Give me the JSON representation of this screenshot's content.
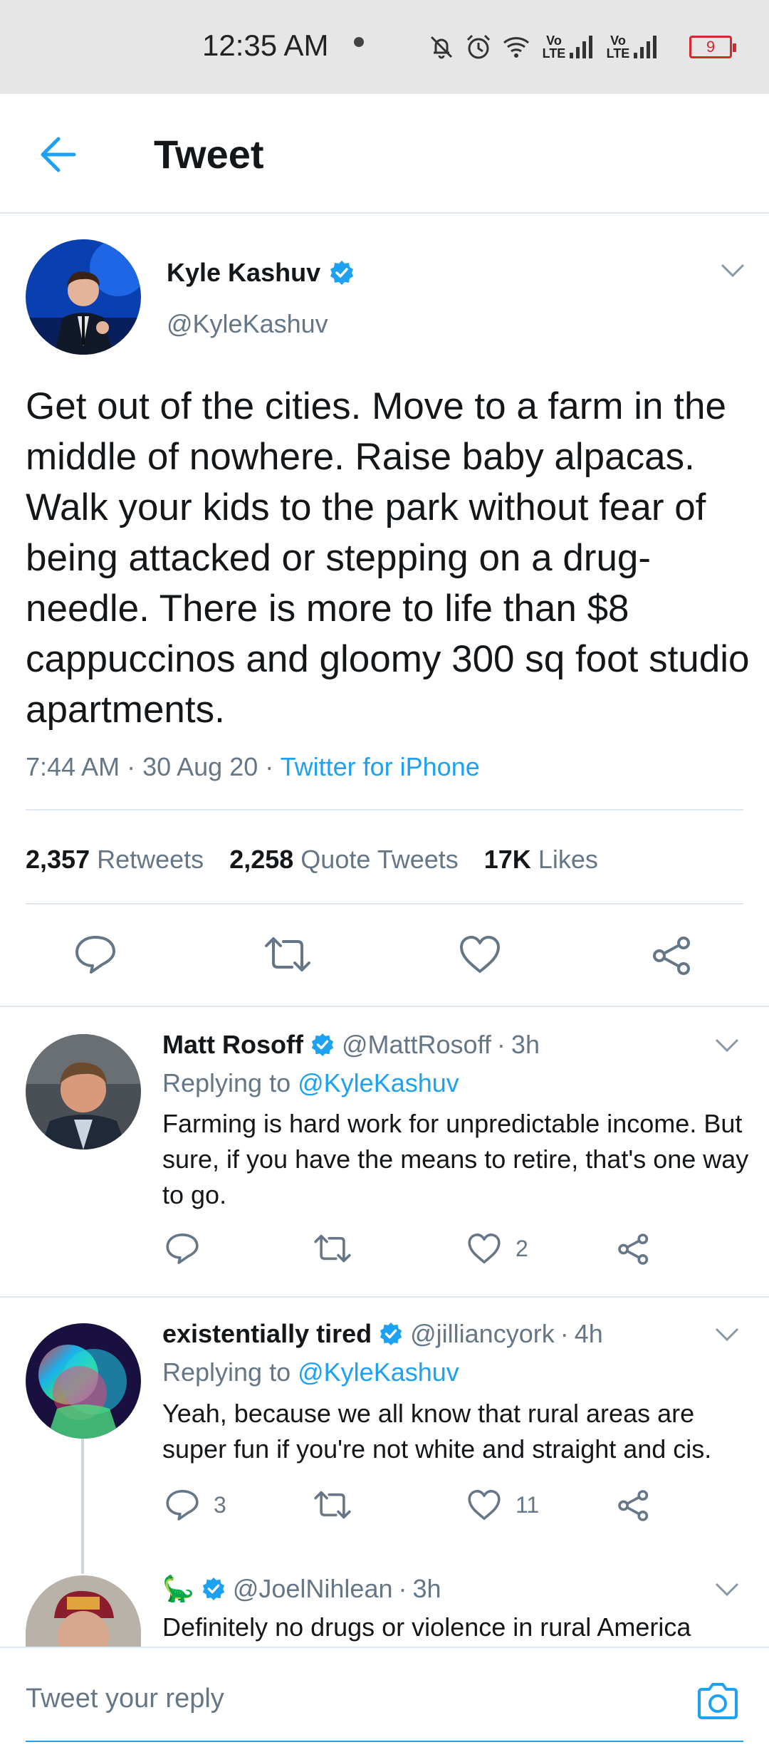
{
  "status_bar": {
    "time": "12:35 AM",
    "network_1": "Vo LTE",
    "network_2": "Vo LTE",
    "battery": "9",
    "icons": [
      "mute-icon",
      "alarm-icon",
      "wifi-icon",
      "signal-icon",
      "signal-icon",
      "battery-icon"
    ]
  },
  "header": {
    "title": "Tweet"
  },
  "tweet": {
    "author_name": "Kyle Kashuv",
    "author_handle": "@KyleKashuv",
    "text": "Get out of the cities. Move to a farm in the middle of nowhere. Raise baby alpacas. Walk your kids to the park without fear of being attacked or stepping on a drug-needle. There is more to life than $8 cappuccinos and gloomy 300 sq foot studio apartments.",
    "time": "7:44 AM",
    "date": "30 Aug 20",
    "source": "Twitter for iPhone",
    "stats": {
      "retweets_count": "2,357",
      "retweets_label": "Retweets",
      "quotes_count": "2,258",
      "quotes_label": "Quote Tweets",
      "likes_count": "17K",
      "likes_label": "Likes"
    }
  },
  "replies": [
    {
      "name": "Matt Rosoff",
      "handle": "@MattRosoff",
      "time": "3h",
      "replying_prefix": "Replying to",
      "replying_to": "@KyleKashuv",
      "text": "Farming is hard work for unpredictable income. But sure, if you have the means to retire, that's one way to go.",
      "reply_count": "",
      "retweet_count": "",
      "like_count": "2"
    },
    {
      "name": "existentially tired",
      "handle": "@jilliancyork",
      "time": "4h",
      "replying_prefix": "Replying to",
      "replying_to": "@KyleKashuv",
      "text": "Yeah, because we all know that rural areas are super fun if you're not white and straight and cis.",
      "reply_count": "3",
      "retweet_count": "",
      "like_count": "11"
    },
    {
      "name": "🦕",
      "handle": "@JoelNihlean",
      "time": "3h",
      "text": "Definitely no drugs or violence in rural America"
    }
  ],
  "composer": {
    "placeholder": "Tweet your reply"
  },
  "colors": {
    "accent": "#1da1f2",
    "secondary_text": "#657786",
    "divider": "#e1e8ed",
    "battery_low": "#d9262c"
  }
}
